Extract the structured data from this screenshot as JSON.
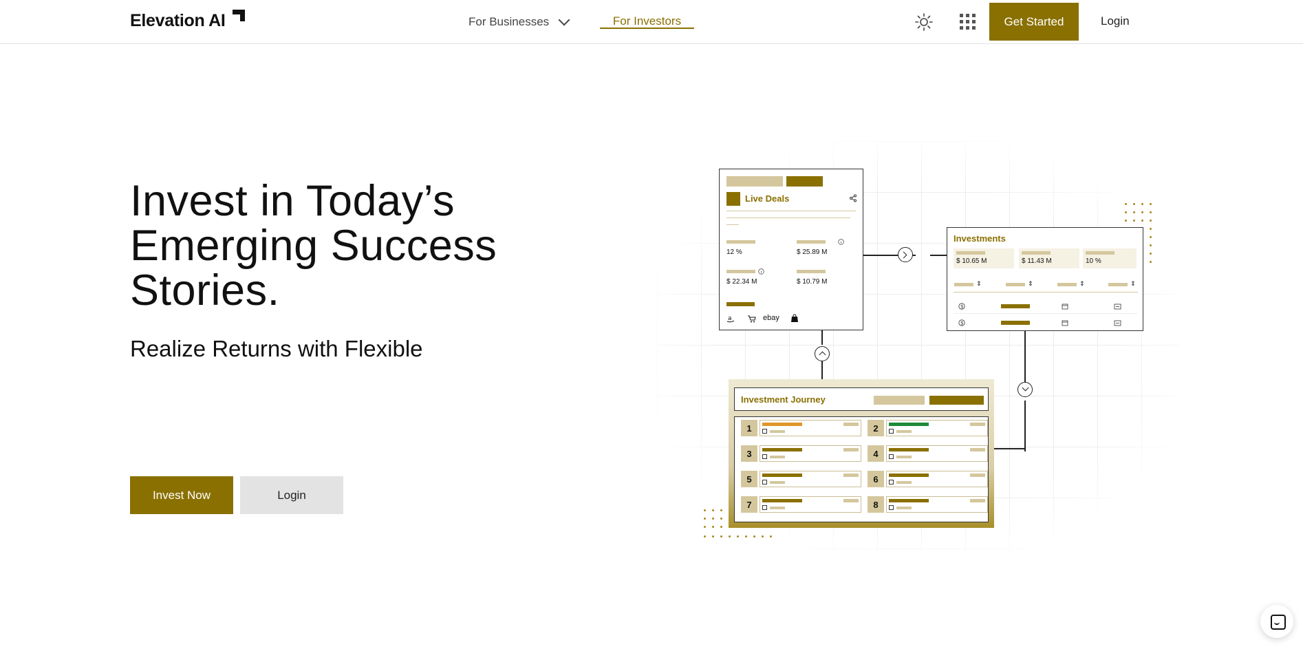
{
  "header": {
    "logo": "Elevation AI",
    "nav": [
      {
        "label": "For Businesses"
      },
      {
        "label": "For Investors"
      }
    ],
    "get_started": "Get Started",
    "login": "Login"
  },
  "hero": {
    "title": "Invest in Today’s Emerging Success Stories.",
    "subtitle": "Realize Returns with Flexible",
    "invest_now": "Invest Now",
    "login": "Login"
  },
  "illustration": {
    "live_deals": {
      "title": "Live Deals",
      "stats": [
        "12 %",
        "$ 25.89 M",
        "$ 22.34 M",
        "$ 10.79 M"
      ],
      "marketplace_logo": "ebay"
    },
    "investments": {
      "title": "Investments",
      "stats": [
        "$ 10.65 M",
        "$ 11.43 M",
        "10 %"
      ]
    },
    "journey": {
      "title": "Investment Journey",
      "steps": [
        "1",
        "2",
        "3",
        "4",
        "5",
        "6",
        "7",
        "8"
      ]
    }
  },
  "colors": {
    "brand": "#8a7000",
    "brand_light": "#d4c79d",
    "step1_accent": "#e0962b",
    "step2_accent": "#1f8a3a"
  }
}
